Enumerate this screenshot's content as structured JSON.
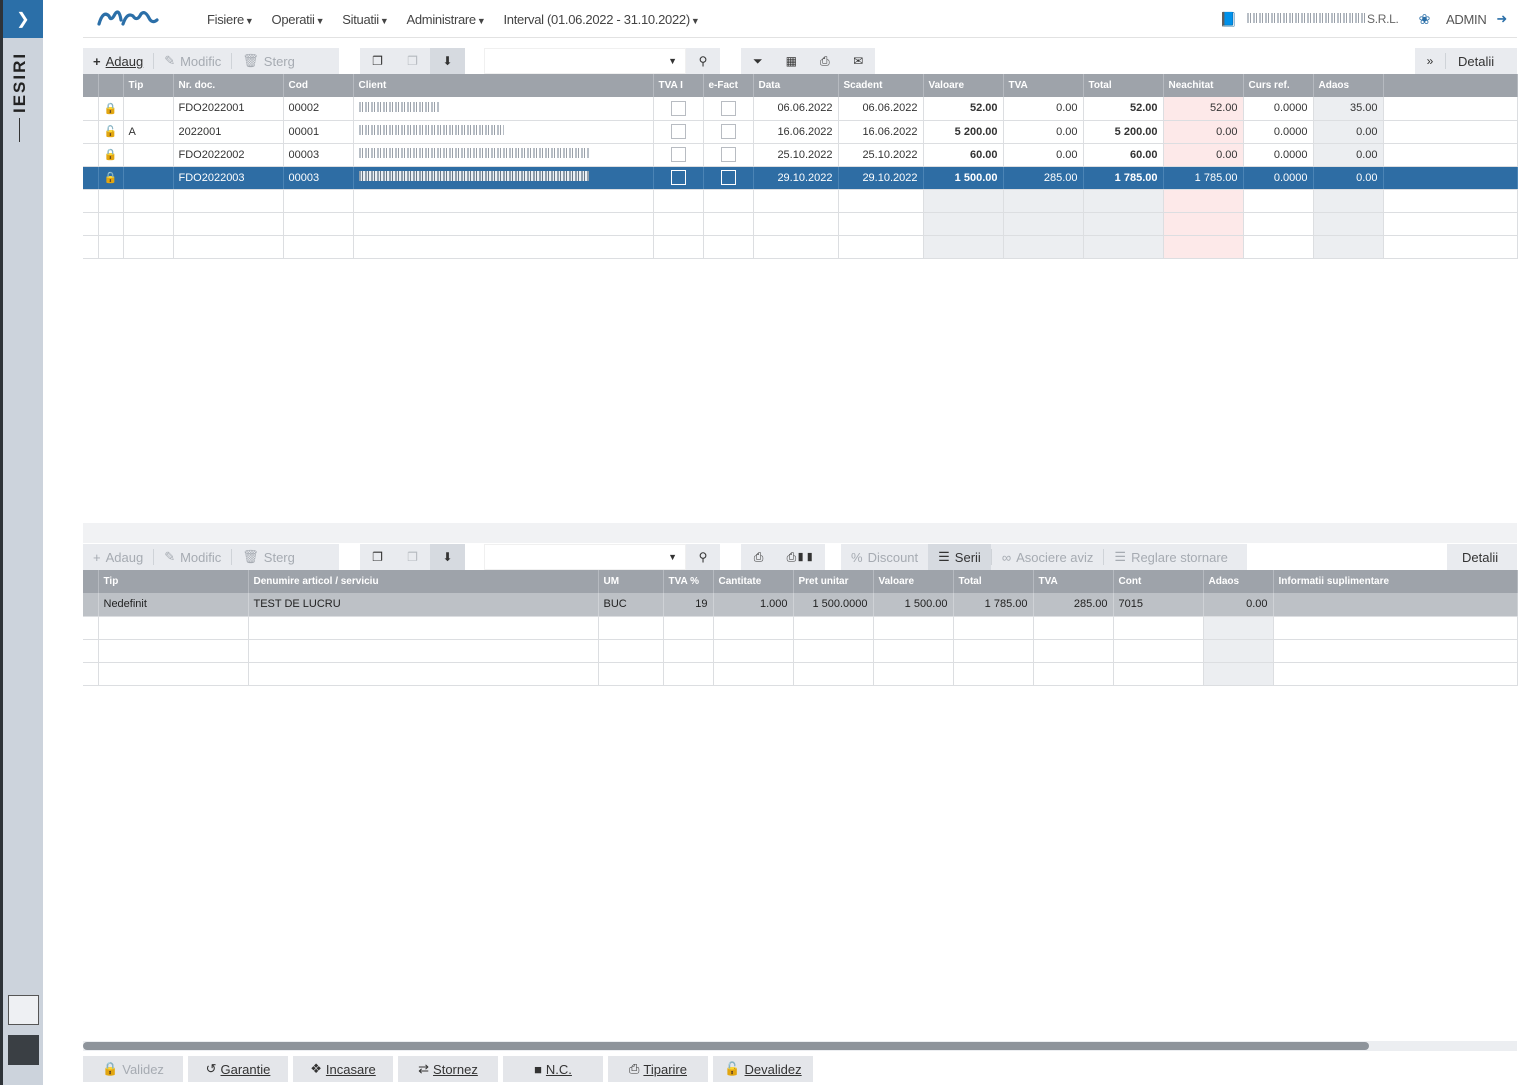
{
  "sidebar": {
    "label": "IESIRI"
  },
  "menu": {
    "items": [
      "Fisiere",
      "Operatii",
      "Situatii",
      "Administrare",
      "Interval (01.06.2022 - 31.10.2022)"
    ],
    "company_suffix": "S.R.L.",
    "user": "ADMIN"
  },
  "toolbar_top": {
    "add": "Adaug",
    "edit": "Modific",
    "delete": "Sterg",
    "details": "Detalii"
  },
  "toolbar_bottom": {
    "add": "Adaug",
    "edit": "Modific",
    "delete": "Sterg",
    "discount": "Discount",
    "series": "Serii",
    "link_notice": "Asociere aviz",
    "reversal": "Reglare stornare",
    "details": "Detalii"
  },
  "docs": {
    "headers": [
      "",
      "",
      "Tip",
      "Nr. doc.",
      "Cod",
      "Client",
      "TVA I",
      "e-Fact",
      "Data",
      "Scadent",
      "Valoare",
      "TVA",
      "Total",
      "Neachitat",
      "Curs ref.",
      "Adaos",
      ""
    ],
    "rows": [
      {
        "lock": "closed",
        "tip": "",
        "nr": "FDO2022001",
        "cod": "00002",
        "data": "06.06.2022",
        "scadent": "06.06.2022",
        "valoare": "52.00",
        "tva": "0.00",
        "total": "52.00",
        "neachitat": "52.00",
        "curs": "0.0000",
        "adaos": "35.00"
      },
      {
        "lock": "open",
        "tip": "A",
        "nr": "2022001",
        "cod": "00001",
        "data": "16.06.2022",
        "scadent": "16.06.2022",
        "valoare": "5 200.00",
        "tva": "0.00",
        "total": "5 200.00",
        "neachitat": "0.00",
        "curs": "0.0000",
        "adaos": "0.00"
      },
      {
        "lock": "closed",
        "tip": "",
        "nr": "FDO2022002",
        "cod": "00003",
        "data": "25.10.2022",
        "scadent": "25.10.2022",
        "valoare": "60.00",
        "tva": "0.00",
        "total": "60.00",
        "neachitat": "0.00",
        "curs": "0.0000",
        "adaos": "0.00"
      },
      {
        "lock": "closed",
        "tip": "",
        "nr": "FDO2022003",
        "cod": "00003",
        "data": "29.10.2022",
        "scadent": "29.10.2022",
        "valoare": "1 500.00",
        "tva": "285.00",
        "total": "1 785.00",
        "neachitat": "1 785.00",
        "curs": "0.0000",
        "adaos": "0.00"
      }
    ]
  },
  "lines": {
    "headers": [
      "",
      "Tip",
      "Denumire articol / serviciu",
      "UM",
      "TVA %",
      "Cantitate",
      "Pret unitar",
      "Valoare",
      "Total",
      "TVA",
      "Cont",
      "Adaos",
      "Informatii suplimentare"
    ],
    "rows": [
      {
        "tip": "Nedefinit",
        "denumire": "TEST DE LUCRU",
        "um": "BUC",
        "tva_pct": "19",
        "cantitate": "1.000",
        "pret": "1 500.0000",
        "valoare": "1 500.00",
        "total": "1 785.00",
        "tva": "285.00",
        "cont": "7015",
        "adaos": "0.00",
        "info": ""
      }
    ]
  },
  "bottom_buttons": [
    "Validez",
    "Garantie",
    "Incasare",
    "Stornez",
    "N.C.",
    "Tiparire",
    "Devalidez"
  ],
  "colors": {
    "accent": "#2e6da4",
    "header": "#9ea3aa",
    "unpaid_bg": "#fde9e9"
  }
}
